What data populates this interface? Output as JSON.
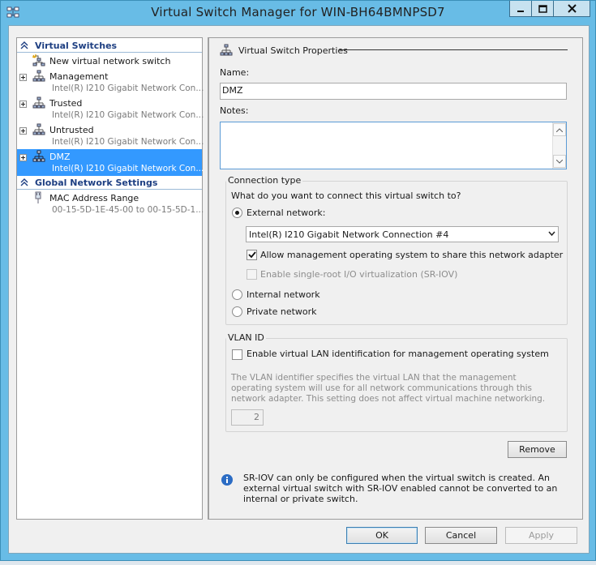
{
  "window": {
    "title": "Virtual Switch Manager for WIN-BH64BMNPSD7",
    "controls": {
      "minimize_icon": "minimize-icon",
      "maximize_icon": "maximize-icon",
      "close_icon": "close-icon"
    }
  },
  "tree": {
    "virtual_switches_header": "Virtual Switches",
    "items": [
      {
        "name": "New virtual network switch",
        "sub": ""
      },
      {
        "name": "Management",
        "sub": "Intel(R) I210 Gigabit Network Con..."
      },
      {
        "name": "Trusted",
        "sub": "Intel(R) I210 Gigabit Network Con..."
      },
      {
        "name": "Untrusted",
        "sub": "Intel(R) I210 Gigabit Network Con..."
      },
      {
        "name": "DMZ",
        "sub": "Intel(R) I210 Gigabit Network Con..."
      }
    ],
    "global_header": "Global Network Settings",
    "mac": {
      "name": "MAC Address Range",
      "sub": "00-15-5D-1E-45-00 to 00-15-5D-1..."
    }
  },
  "props": {
    "header": "Virtual Switch Properties",
    "name_label": "Name:",
    "name_value": "DMZ",
    "notes_label": "Notes:",
    "connection_type": {
      "title": "Connection type",
      "question": "What do you want to connect this virtual switch to?",
      "external_label": "External network:",
      "adapter_selected": "Intel(R) I210 Gigabit Network Connection #4",
      "allow_mgmt_label": "Allow management operating system to share this network adapter",
      "sriov_label": "Enable single-root I/O virtualization (SR-IOV)",
      "internal_label": "Internal network",
      "private_label": "Private network"
    },
    "vlan": {
      "title": "VLAN ID",
      "enable_label": "Enable virtual LAN identification for management operating system",
      "description": "The VLAN identifier specifies the virtual LAN that the management operating system will use for all network communications through this network adapter. This setting does not affect virtual machine networking.",
      "value": "2"
    },
    "remove_label": "Remove",
    "info_text": "SR-IOV can only be configured when the virtual switch is created. An external virtual switch with SR-IOV enabled cannot be converted to an internal or private switch."
  },
  "footer": {
    "ok": "OK",
    "cancel": "Cancel",
    "apply": "Apply"
  },
  "colors": {
    "selection": "#3399ff",
    "header_text": "#1e3f82",
    "frame": "#68bce6"
  }
}
